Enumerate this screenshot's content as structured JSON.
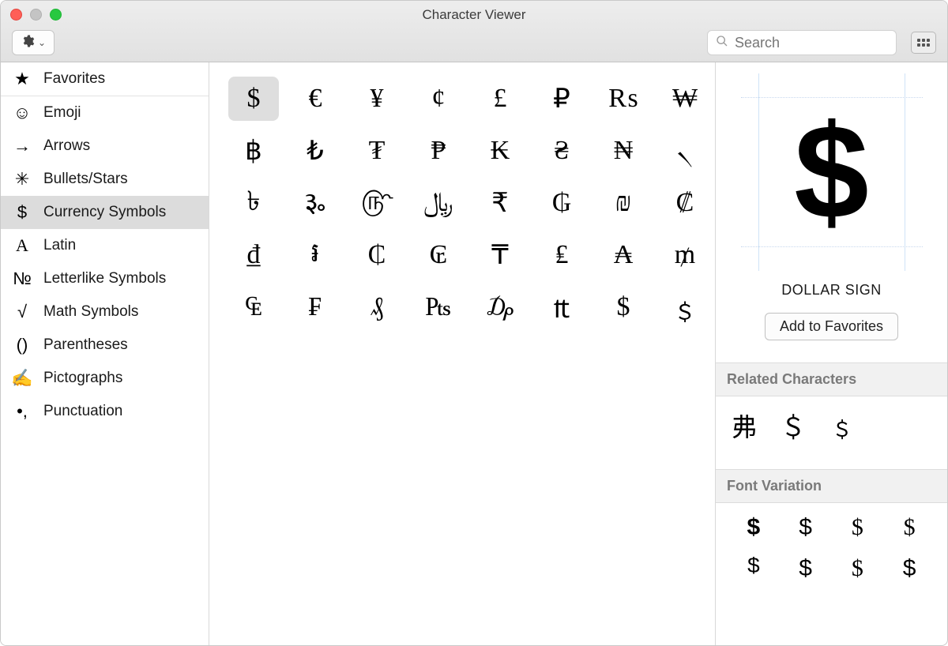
{
  "window": {
    "title": "Character Viewer"
  },
  "search": {
    "placeholder": "Search"
  },
  "sidebar": {
    "favorites": {
      "label": "Favorites",
      "icon": "★"
    },
    "items": [
      {
        "label": "Emoji",
        "icon": "☺"
      },
      {
        "label": "Arrows",
        "icon": "→"
      },
      {
        "label": "Bullets/Stars",
        "icon": "✳"
      },
      {
        "label": "Currency Symbols",
        "icon": "$",
        "selected": true
      },
      {
        "label": "Latin",
        "icon": "A"
      },
      {
        "label": "Letterlike Symbols",
        "icon": "№"
      },
      {
        "label": "Math Symbols",
        "icon": "√"
      },
      {
        "label": "Parentheses",
        "icon": "()"
      },
      {
        "label": "Pictographs",
        "icon": "✍"
      },
      {
        "label": "Punctuation",
        "icon": "•,"
      }
    ]
  },
  "characters": [
    "$",
    "€",
    "¥",
    "¢",
    "£",
    "₽",
    "₨",
    "₩",
    "฿",
    "₺",
    "₮",
    "₱",
    "₭",
    "₴",
    "₦",
    "৲",
    "৳",
    "૱",
    "௹",
    "﷼",
    "₹",
    "₲",
    "₪",
    "₡",
    "₫",
    "៛",
    "₵",
    "₢",
    "₸",
    "₤",
    "₳",
    "₥",
    "₠",
    "₣",
    "₰",
    "₧",
    "₯",
    "₶",
    "$",
    "﹩"
  ],
  "selected_index": 0,
  "detail": {
    "glyph": "$",
    "name": "DOLLAR SIGN",
    "add_favorites": "Add to Favorites",
    "related_header": "Related Characters",
    "related": [
      "弗",
      "＄",
      "﹩"
    ],
    "font_variation_header": "Font Variation",
    "font_variations": [
      "$",
      "$",
      "$",
      "$",
      "$",
      "$",
      "$",
      "$"
    ]
  }
}
